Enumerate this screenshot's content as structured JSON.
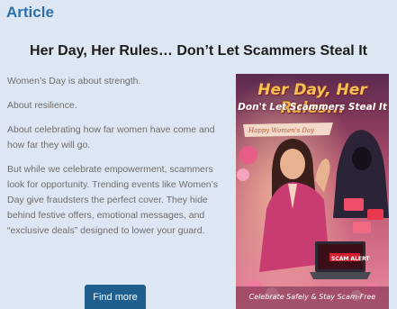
{
  "section": {
    "label": "Article"
  },
  "article": {
    "headline": "Her Day, Her Rules… Don’t Let Scammers Steal It",
    "paragraphs": [
      "Women’s Day is about strength.",
      "About resilience.",
      "About celebrating how far women have come and how far they will go.",
      "But while we celebrate empowerment, scammers look for opportunity. Trending events like Women’s Day give fraudsters the perfect cover. They hide behind festive offers, emotional messages, and “exclusive deals” designed to lower your guard."
    ],
    "cta_label": "Find more"
  },
  "poster": {
    "title": "Her Day, Her Rules...",
    "subtitle": "Don't Let Scammers Steal It",
    "banner": "Happy Women's Day",
    "alert": "SCAM ALERT",
    "footer": "Celebrate Safely & Stay Scam-Free"
  },
  "colors": {
    "page_background": "#dde7f3",
    "section_label": "#2f6fa7",
    "cta_background": "#1f5f8f",
    "poster_title": "#f3c24f"
  }
}
